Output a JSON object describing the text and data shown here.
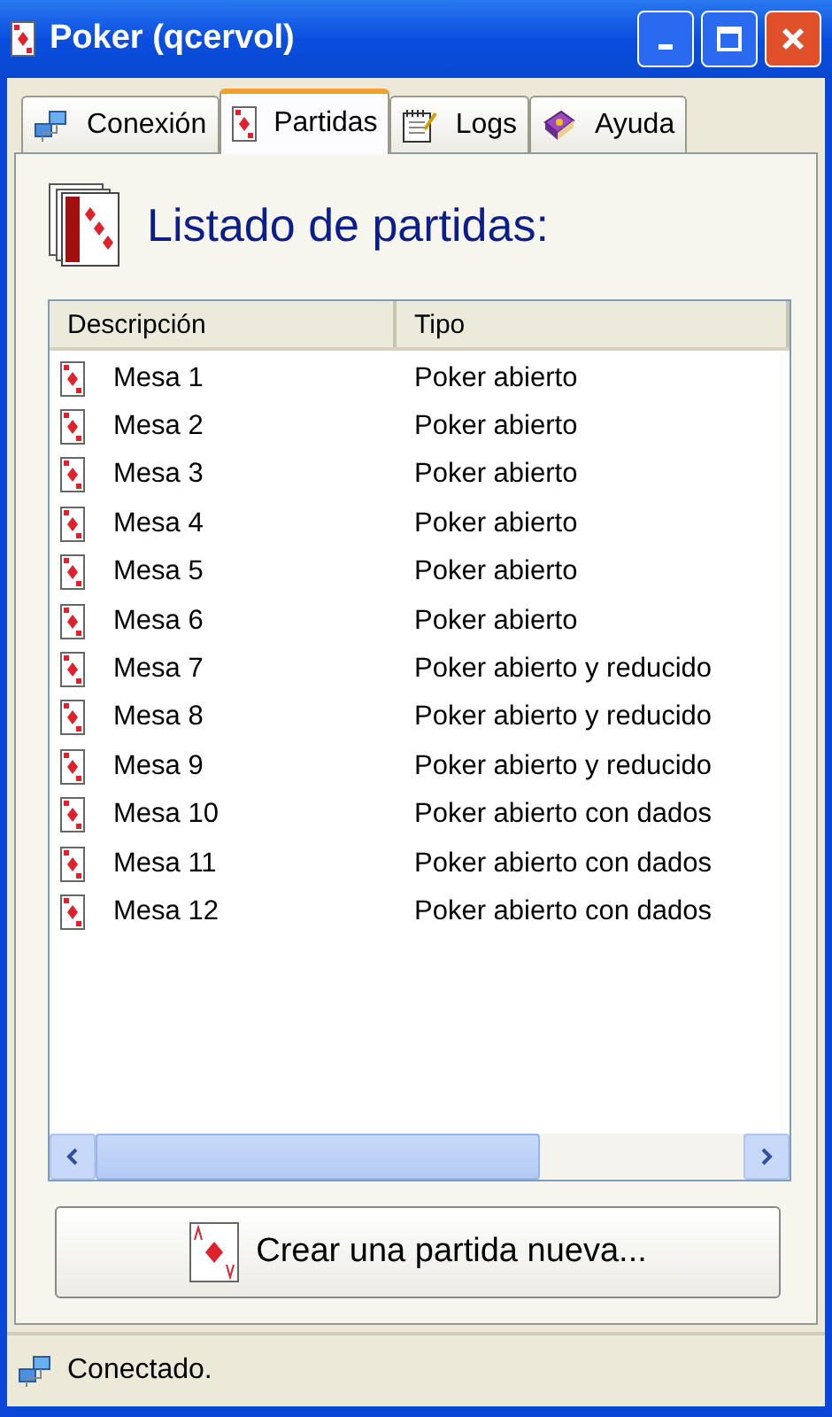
{
  "window": {
    "title": "Poker (qcervol)"
  },
  "tabs": [
    {
      "label": "Conexión",
      "selected": false
    },
    {
      "label": "Partidas",
      "selected": true
    },
    {
      "label": "Logs",
      "selected": false
    },
    {
      "label": "Ayuda",
      "selected": false
    }
  ],
  "heading": "Listado de partidas:",
  "table": {
    "columns": [
      "Descripción",
      "Tipo"
    ],
    "rows": [
      [
        "Mesa 1",
        "Poker abierto"
      ],
      [
        "Mesa 2",
        "Poker abierto"
      ],
      [
        "Mesa 3",
        "Poker abierto"
      ],
      [
        "Mesa 4",
        "Poker abierto"
      ],
      [
        "Mesa 5",
        "Poker abierto"
      ],
      [
        "Mesa 6",
        "Poker abierto"
      ],
      [
        "Mesa 7",
        "Poker abierto y reducido"
      ],
      [
        "Mesa 8",
        "Poker abierto y reducido"
      ],
      [
        "Mesa 9",
        "Poker abierto y reducido"
      ],
      [
        "Mesa 10",
        "Poker abierto con dados"
      ],
      [
        "Mesa 11",
        "Poker abierto con dados"
      ],
      [
        "Mesa 12",
        "Poker abierto con dados"
      ]
    ]
  },
  "create_button": "Crear una partida nueva...",
  "status_bar": "Conectado."
}
